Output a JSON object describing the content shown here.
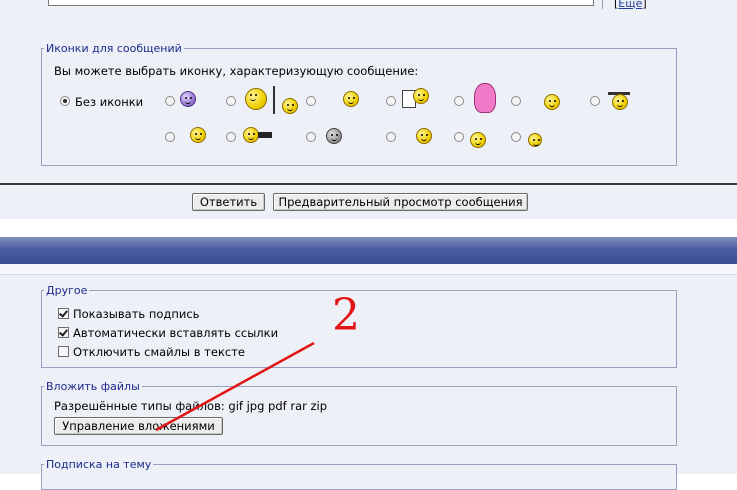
{
  "editor": {
    "more_link": "Ещё"
  },
  "icons_section": {
    "legend": "Иконки для сообщений",
    "description": "Вы можете выбрать иконку, характеризующую сообщение:",
    "no_icon_label": "Без иконки",
    "selected": "no-icon",
    "icons": [
      "sad-smiley-icon",
      "photographer-smiley-icon",
      "grin-smiley-icon",
      "writer-smiley-icon",
      "pink-monster-icon",
      "cheerleader-smiley-icon",
      "graduate-smiley-icon",
      "bouncing-smiley-icon",
      "helmet-smiley-icon",
      "grey-blob-icon",
      "doctor-smiley-icon",
      "thumbs-up-smiley-icon",
      "plain-smiley-icon"
    ]
  },
  "actions": {
    "reply_button": "Ответить",
    "preview_button": "Предварительный просмотр сообщения"
  },
  "other_section": {
    "legend": "Другое",
    "options": [
      {
        "label": "Показывать подпись",
        "checked": true
      },
      {
        "label": "Автоматически вставлять ссылки",
        "checked": true
      },
      {
        "label": "Отключить смайлы в тексте",
        "checked": false
      }
    ]
  },
  "attach_section": {
    "legend": "Вложить файлы",
    "allowed_types": "Разрешённые типы файлов: gif jpg pdf rar zip",
    "manage_button": "Управление вложениями"
  },
  "subscribe_section": {
    "legend": "Подписка на тему"
  },
  "annotation": {
    "number": "2",
    "color": "#e11515"
  }
}
